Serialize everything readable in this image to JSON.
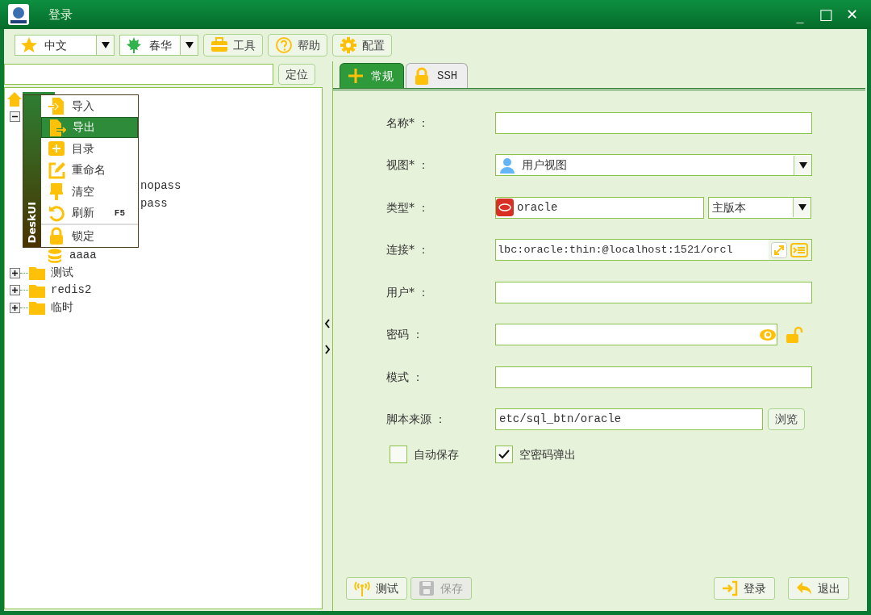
{
  "window": {
    "title": "登录",
    "buttons": [
      "_",
      "□",
      "✕"
    ]
  },
  "toolbar": {
    "language": {
      "value": "中文"
    },
    "theme": {
      "value": "春华"
    },
    "buttons": [
      {
        "kind": "tools",
        "label": "工具"
      },
      {
        "kind": "help",
        "label": "帮助"
      },
      {
        "kind": "config",
        "label": "配置"
      }
    ]
  },
  "locate": {
    "button": "定位"
  },
  "tree": {
    "nodes": [
      {
        "kind": "group",
        "expanded": true,
        "children": [
          {
            "kind": "cut",
            "label": "nopass"
          },
          {
            "kind": "cut",
            "label": "pass"
          },
          {
            "kind": "database",
            "label": "aaaa"
          }
        ]
      },
      {
        "kind": "folder",
        "label": "测试",
        "expanded": false
      },
      {
        "kind": "folder",
        "label": "redis2",
        "expanded": false
      },
      {
        "kind": "folder",
        "label": "临时",
        "expanded": false
      }
    ]
  },
  "context_menu": {
    "brand": "DeskUI",
    "items": [
      {
        "label": "导入",
        "selected": false
      },
      {
        "label": "导出",
        "selected": true
      },
      {
        "label": "目录",
        "selected": false
      },
      {
        "label": "重命名",
        "selected": false
      },
      {
        "label": "清空",
        "selected": false
      },
      {
        "label": "刷新",
        "shortcut": "F5",
        "selected": false
      },
      {
        "label": "锁定",
        "selected": false,
        "separator_before": true
      }
    ]
  },
  "tabs": [
    {
      "label": "常规",
      "selected": true
    },
    {
      "label": "SSH",
      "selected": false
    }
  ],
  "form": [
    {
      "kind": "text",
      "label": "名称* ："
    },
    {
      "kind": "select",
      "label": "视图* ：",
      "value": "用户视图"
    },
    {
      "kind": "type",
      "label": "类型* ：",
      "value": "oracle",
      "version": "主版本"
    },
    {
      "kind": "url",
      "label": "连接* ：",
      "value": "lbc:oracle:thin:@localhost:1521/orcl"
    },
    {
      "kind": "text",
      "label": "用户* ："
    },
    {
      "kind": "password",
      "label": "密码 ："
    },
    {
      "kind": "text",
      "label": "模式 ："
    },
    {
      "kind": "browse",
      "label": "脚本来源 ：",
      "value": "etc/sql_btn/oracle",
      "button": "浏览"
    }
  ],
  "checkboxes": [
    {
      "label": "自动保存",
      "checked": false
    },
    {
      "label": "空密码弹出",
      "checked": true
    }
  ],
  "footer": {
    "left": [
      {
        "kind": "test",
        "label": "测试",
        "disabled": false
      },
      {
        "kind": "save",
        "label": "保存",
        "disabled": true
      }
    ],
    "right": [
      {
        "kind": "login",
        "label": "登录",
        "disabled": false
      },
      {
        "kind": "exit",
        "label": "退出",
        "disabled": false
      }
    ]
  }
}
